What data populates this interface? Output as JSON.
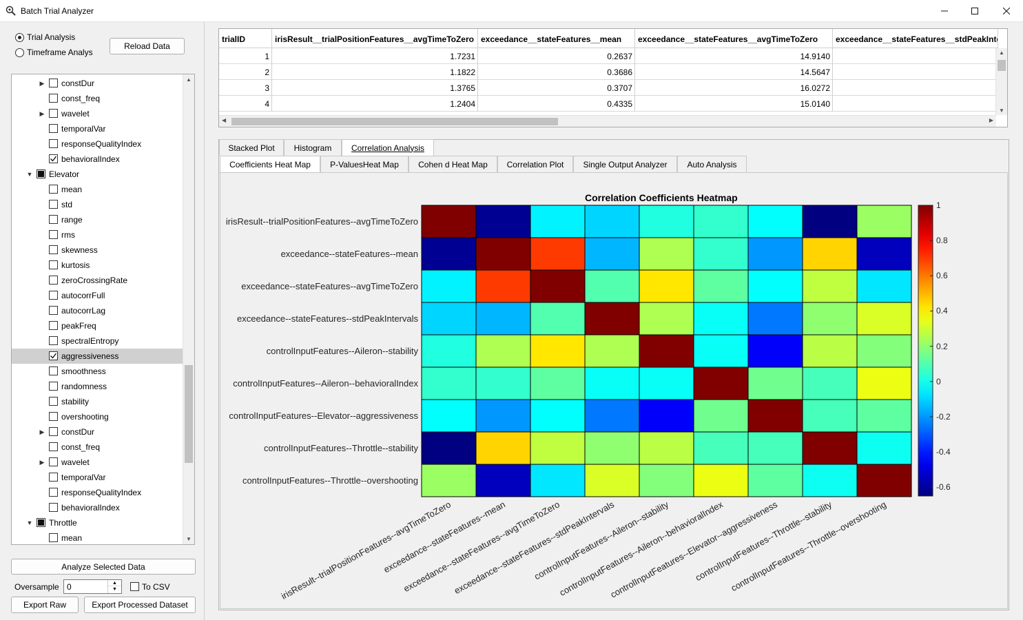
{
  "window": {
    "title": "Batch Trial Analyzer"
  },
  "left": {
    "radio_trial": "Trial Analysis",
    "radio_timeframe": "Timeframe Analys",
    "reload_label": "Reload Data",
    "analyze_label": "Analyze Selected Data",
    "oversample_label": "Oversample",
    "oversample_value": "0",
    "tocsv_label": "To CSV",
    "export_raw_label": "Export Raw",
    "export_processed_label": "Export Processed Dataset"
  },
  "tree": [
    {
      "label": "constDur",
      "level": 2,
      "expander": "right",
      "check": "empty"
    },
    {
      "label": "const_freq",
      "level": 2,
      "expander": "none",
      "check": "empty"
    },
    {
      "label": "wavelet",
      "level": 2,
      "expander": "right",
      "check": "empty"
    },
    {
      "label": "temporalVar",
      "level": 2,
      "expander": "none",
      "check": "empty"
    },
    {
      "label": "responseQualityIndex",
      "level": 2,
      "expander": "none",
      "check": "empty"
    },
    {
      "label": "behavioralIndex",
      "level": 2,
      "expander": "none",
      "check": "checked"
    },
    {
      "label": "Elevator",
      "level": 1,
      "expander": "down",
      "check": "partial"
    },
    {
      "label": "mean",
      "level": 2,
      "expander": "none",
      "check": "empty"
    },
    {
      "label": "std",
      "level": 2,
      "expander": "none",
      "check": "empty"
    },
    {
      "label": "range",
      "level": 2,
      "expander": "none",
      "check": "empty"
    },
    {
      "label": "rms",
      "level": 2,
      "expander": "none",
      "check": "empty"
    },
    {
      "label": "skewness",
      "level": 2,
      "expander": "none",
      "check": "empty"
    },
    {
      "label": "kurtosis",
      "level": 2,
      "expander": "none",
      "check": "empty"
    },
    {
      "label": "zeroCrossingRate",
      "level": 2,
      "expander": "none",
      "check": "empty"
    },
    {
      "label": "autocorrFull",
      "level": 2,
      "expander": "none",
      "check": "empty"
    },
    {
      "label": "autocorrLag",
      "level": 2,
      "expander": "none",
      "check": "empty"
    },
    {
      "label": "peakFreq",
      "level": 2,
      "expander": "none",
      "check": "empty"
    },
    {
      "label": "spectralEntropy",
      "level": 2,
      "expander": "none",
      "check": "empty"
    },
    {
      "label": "aggressiveness",
      "level": 2,
      "expander": "none",
      "check": "checked",
      "selected": true
    },
    {
      "label": "smoothness",
      "level": 2,
      "expander": "none",
      "check": "empty"
    },
    {
      "label": "randomness",
      "level": 2,
      "expander": "none",
      "check": "empty"
    },
    {
      "label": "stability",
      "level": 2,
      "expander": "none",
      "check": "empty"
    },
    {
      "label": "overshooting",
      "level": 2,
      "expander": "none",
      "check": "empty"
    },
    {
      "label": "constDur",
      "level": 2,
      "expander": "right",
      "check": "empty"
    },
    {
      "label": "const_freq",
      "level": 2,
      "expander": "none",
      "check": "empty"
    },
    {
      "label": "wavelet",
      "level": 2,
      "expander": "right",
      "check": "empty"
    },
    {
      "label": "temporalVar",
      "level": 2,
      "expander": "none",
      "check": "empty"
    },
    {
      "label": "responseQualityIndex",
      "level": 2,
      "expander": "none",
      "check": "empty"
    },
    {
      "label": "behavioralIndex",
      "level": 2,
      "expander": "none",
      "check": "empty"
    },
    {
      "label": "Throttle",
      "level": 1,
      "expander": "down",
      "check": "partial"
    },
    {
      "label": "mean",
      "level": 2,
      "expander": "none",
      "check": "empty"
    }
  ],
  "table": {
    "columns": [
      "trialID",
      "irisResult__trialPositionFeatures__avgTimeToZero",
      "exceedance__stateFeatures__mean",
      "exceedance__stateFeatures__avgTimeToZero",
      "exceedance__stateFeatures__stdPeakIntervals"
    ],
    "rows": [
      [
        "1",
        "1.7231",
        "0.2637",
        "14.9140",
        ""
      ],
      [
        "2",
        "1.1822",
        "0.3686",
        "14.5647",
        ""
      ],
      [
        "3",
        "1.3765",
        "0.3707",
        "16.0272",
        ""
      ],
      [
        "4",
        "1.2404",
        "0.4335",
        "15.0140",
        ""
      ]
    ]
  },
  "tabs": {
    "outer": [
      "Stacked Plot",
      "Histogram",
      "Correlation Analysis"
    ],
    "outer_active": 2,
    "inner": [
      "Coefficients Heat Map",
      "P-ValuesHeat Map",
      "Cohen d Heat Map",
      "Correlation Plot",
      "Single Output Analyzer",
      "Auto Analysis"
    ],
    "inner_active": 0
  },
  "chart_data": {
    "type": "heatmap",
    "title": "Correlation Coefficients  Heatmap",
    "labels": [
      "irisResult--trialPositionFeatures--avgTimeToZero",
      "exceedance--stateFeatures--mean",
      "exceedance--stateFeatures--avgTimeToZero",
      "exceedance--stateFeatures--stdPeakIntervals",
      "controlInputFeatures--Aileron--stability",
      "controlInputFeatures--Aileron--behavioralIndex",
      "controlInputFeatures--Elevator--aggressiveness",
      "controlInputFeatures--Throttle--stability",
      "controlInputFeatures--Throttle--overshooting"
    ],
    "matrix": [
      [
        1.0,
        -0.62,
        -0.05,
        -0.1,
        0.02,
        0.05,
        -0.03,
        -0.65,
        0.22
      ],
      [
        -0.62,
        1.0,
        0.7,
        -0.15,
        0.25,
        0.05,
        -0.2,
        0.45,
        -0.55
      ],
      [
        -0.05,
        0.7,
        1.0,
        0.1,
        0.42,
        0.12,
        -0.03,
        0.28,
        -0.07
      ],
      [
        -0.1,
        -0.15,
        0.1,
        1.0,
        0.25,
        -0.02,
        -0.25,
        0.2,
        0.32
      ],
      [
        0.02,
        0.25,
        0.42,
        0.25,
        1.0,
        -0.02,
        -0.45,
        0.27,
        0.18
      ],
      [
        0.05,
        0.05,
        0.12,
        -0.02,
        -0.02,
        1.0,
        0.15,
        0.08,
        0.35
      ],
      [
        -0.03,
        -0.2,
        -0.03,
        -0.25,
        -0.45,
        0.15,
        1.0,
        0.08,
        0.12
      ],
      [
        -0.65,
        0.45,
        0.28,
        0.2,
        0.27,
        0.08,
        0.08,
        1.0,
        -0.01
      ],
      [
        0.22,
        -0.55,
        -0.07,
        0.32,
        0.18,
        0.35,
        0.12,
        -0.01,
        1.0
      ]
    ],
    "colorbar": {
      "min": -0.65,
      "max": 1.0,
      "ticks": [
        "1",
        "0.8",
        "0.6",
        "0.4",
        "0.2",
        "0",
        "-0.2",
        "-0.4",
        "-0.6"
      ],
      "colormap": "jet"
    }
  }
}
